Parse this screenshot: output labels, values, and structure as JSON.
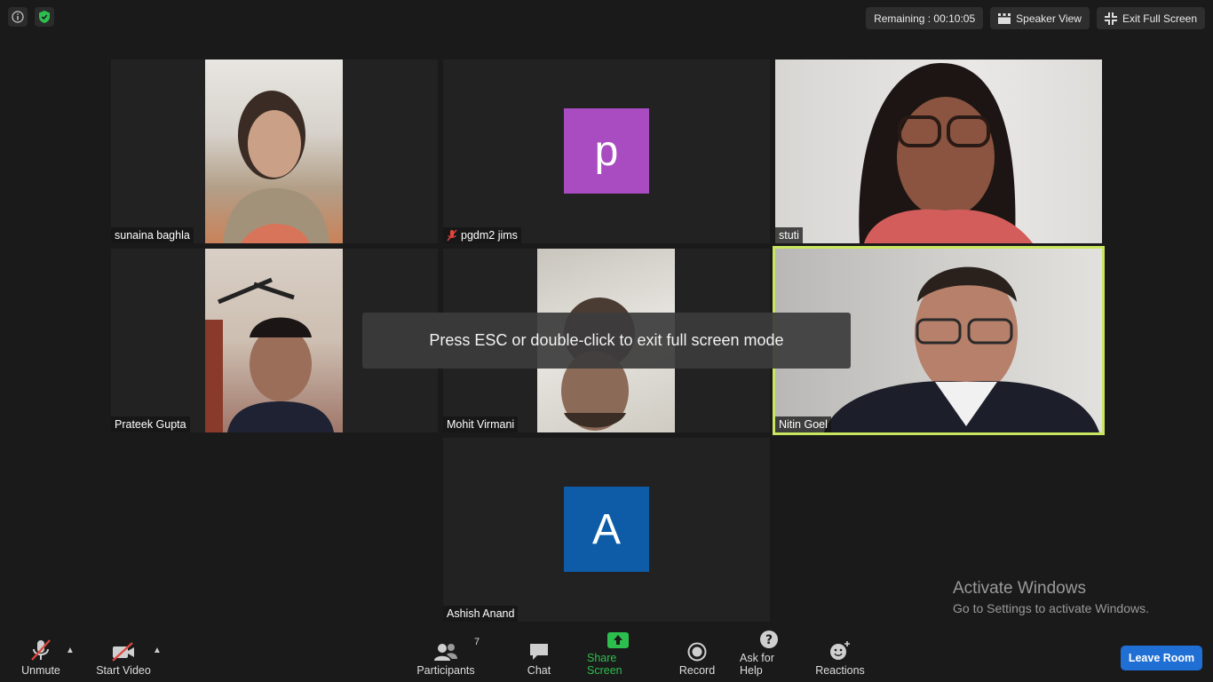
{
  "top_bar": {
    "remaining_label": "Remaining : 00:10:05",
    "speaker_view_label": "Speaker View",
    "exit_full_screen_label": "Exit Full Screen"
  },
  "participants_grid": [
    {
      "name": "sunaina baghla",
      "muted": false,
      "video": true
    },
    {
      "name": "pgdm2 jims",
      "muted": true,
      "video": false,
      "avatar_letter": "p",
      "avatar_color": "#a94cc1"
    },
    {
      "name": "stuti",
      "muted": false,
      "video": true
    },
    {
      "name": "Prateek Gupta",
      "muted": false,
      "video": true
    },
    {
      "name": "Mohit Virmani",
      "muted": false,
      "video": true
    },
    {
      "name": "Nitin Goel",
      "muted": false,
      "video": true,
      "active_speaker": true
    },
    {
      "name": "Ashish Anand",
      "muted": false,
      "video": false,
      "avatar_letter": "A",
      "avatar_color": "#0e5ca7"
    }
  ],
  "toast": "Press ESC or double-click to exit full screen mode",
  "watermark": {
    "title": "Activate Windows",
    "subtitle": "Go to Settings to activate Windows."
  },
  "toolbar": {
    "unmute_label": "Unmute",
    "start_video_label": "Start Video",
    "participants_label": "Participants",
    "participants_count": "7",
    "chat_label": "Chat",
    "share_screen_label": "Share Screen",
    "record_label": "Record",
    "ask_for_help_label": "Ask for Help",
    "reactions_label": "Reactions",
    "leave_label": "Leave Room",
    "share_color": "#2dbf4e",
    "leave_color": "#1f6fd4"
  }
}
